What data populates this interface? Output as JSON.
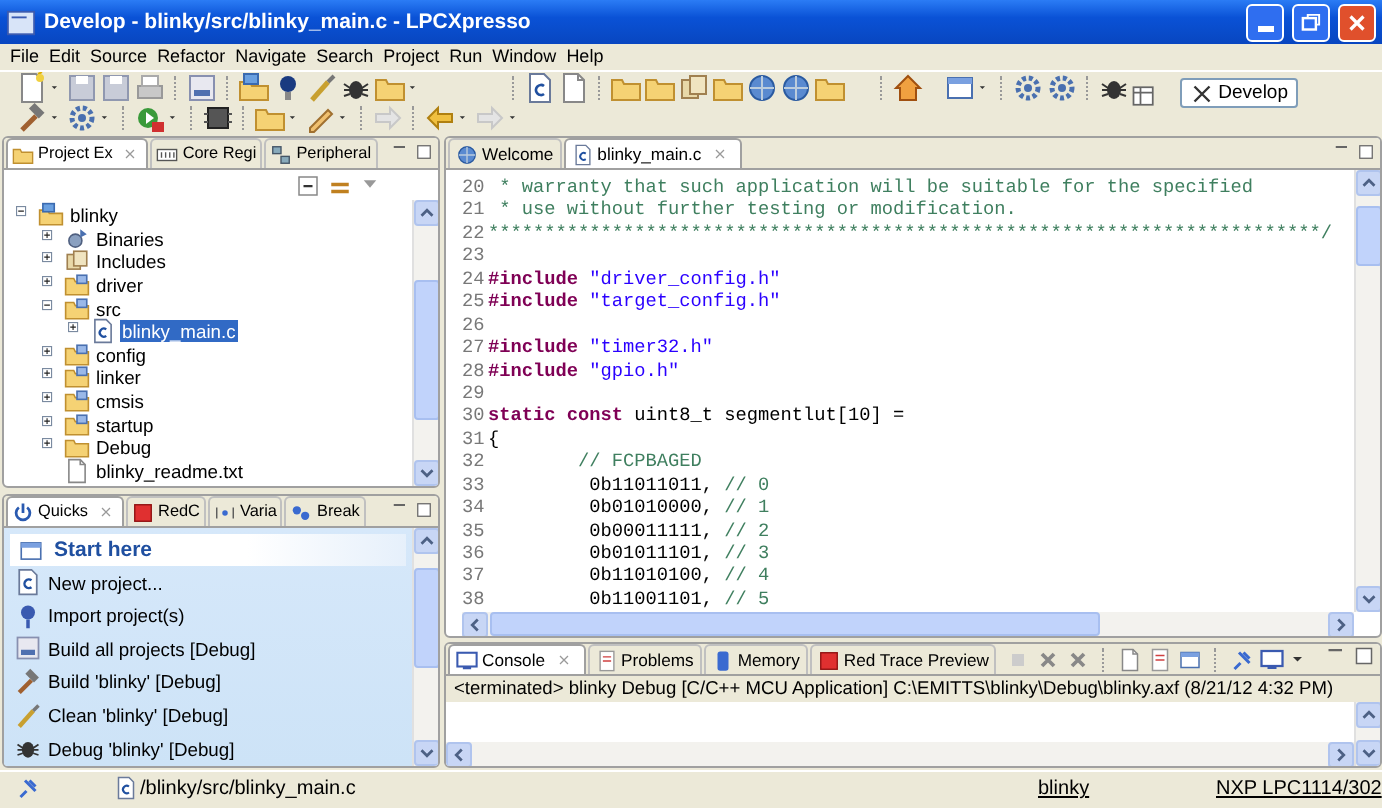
{
  "window": {
    "title": "Develop - blinky/src/blinky_main.c - LPCXpresso"
  },
  "menu": [
    "File",
    "Edit",
    "Source",
    "Refactor",
    "Navigate",
    "Search",
    "Project",
    "Run",
    "Window",
    "Help"
  ],
  "perspective": {
    "label": "Develop",
    "selected": true
  },
  "explorer_tabs": [
    {
      "label": "Project Ex",
      "selected": true
    },
    {
      "label": "Core Regi",
      "selected": false
    },
    {
      "label": "Peripheral",
      "selected": false
    }
  ],
  "tree": [
    {
      "label": "blinky",
      "kind": "project",
      "expanded": true,
      "selected": false,
      "children": [
        {
          "label": "Binaries",
          "kind": "binaries",
          "expanded": false,
          "selected": false
        },
        {
          "label": "Includes",
          "kind": "includes",
          "expanded": false,
          "selected": false
        },
        {
          "label": "driver",
          "kind": "folder",
          "expanded": false,
          "selected": false
        },
        {
          "label": "src",
          "kind": "folder",
          "expanded": true,
          "selected": false,
          "children": [
            {
              "label": "blinky_main.c",
              "kind": "c-file",
              "expanded": false,
              "selected": true
            }
          ]
        },
        {
          "label": "config",
          "kind": "folder",
          "expanded": false,
          "selected": false
        },
        {
          "label": "linker",
          "kind": "folder",
          "expanded": false,
          "selected": false
        },
        {
          "label": "cmsis",
          "kind": "folder",
          "expanded": false,
          "selected": false
        },
        {
          "label": "startup",
          "kind": "folder",
          "expanded": false,
          "selected": false
        },
        {
          "label": "Debug",
          "kind": "plain-folder",
          "expanded": false,
          "selected": false
        },
        {
          "label": "blinky_readme.txt",
          "kind": "text-file",
          "selected": false
        }
      ]
    }
  ],
  "quick_tabs": [
    {
      "label": "Quicks",
      "selected": true
    },
    {
      "label": "RedC",
      "selected": false
    },
    {
      "label": "Varia",
      "selected": false
    },
    {
      "label": "Break",
      "selected": false
    }
  ],
  "quick_panel": {
    "header": "Start here",
    "items": [
      {
        "kind": "new",
        "label": "New project..."
      },
      {
        "kind": "import",
        "label": "Import project(s)"
      },
      {
        "kind": "build-all",
        "label": "Build all projects [Debug]"
      },
      {
        "kind": "build",
        "label": "Build 'blinky' [Debug]"
      },
      {
        "kind": "clean",
        "label": "Clean 'blinky' [Debug]"
      },
      {
        "kind": "debug",
        "label": "Debug 'blinky' [Debug]"
      }
    ]
  },
  "editor_tabs": [
    {
      "label": "Welcome",
      "selected": false
    },
    {
      "label": "blinky_main.c",
      "selected": true
    }
  ],
  "code_lines": [
    {
      "number": "20",
      "parts": [
        {
          "kind": "comment",
          "text": " * warranty that such application will be suitable for the specified"
        }
      ]
    },
    {
      "number": "21",
      "parts": [
        {
          "kind": "comment",
          "text": " * use without further testing or modification."
        }
      ]
    },
    {
      "number": "22",
      "parts": [
        {
          "kind": "comment",
          "text": "**************************************************************************/"
        }
      ]
    },
    {
      "number": "23"
    },
    {
      "number": "24",
      "parts": [
        {
          "kind": "keyword",
          "text": "#include "
        },
        {
          "kind": "string",
          "text": "\"driver_config.h\""
        }
      ]
    },
    {
      "number": "25",
      "parts": [
        {
          "kind": "keyword",
          "text": "#include "
        },
        {
          "kind": "string",
          "text": "\"target_config.h\""
        }
      ]
    },
    {
      "number": "26"
    },
    {
      "number": "27",
      "parts": [
        {
          "kind": "keyword",
          "text": "#include "
        },
        {
          "kind": "string",
          "text": "\"timer32.h\""
        }
      ]
    },
    {
      "number": "28",
      "parts": [
        {
          "kind": "keyword",
          "text": "#include "
        },
        {
          "kind": "string",
          "text": "\"gpio.h\""
        }
      ]
    },
    {
      "number": "29"
    },
    {
      "number": "30",
      "parts": [
        {
          "kind": "keyword",
          "text": "static const"
        },
        {
          "kind": "plain",
          "text": " uint8_t segmentlut[10] ="
        }
      ]
    },
    {
      "number": "31",
      "parts": [
        {
          "kind": "plain",
          "text": "{"
        }
      ]
    },
    {
      "number": "32",
      "parts": [
        {
          "kind": "comment",
          "text": "        // FCPBAGED"
        }
      ]
    },
    {
      "number": "33",
      "parts": [
        {
          "kind": "plain",
          "text": "         0b11011011, "
        },
        {
          "kind": "comment",
          "text": "// 0"
        }
      ]
    },
    {
      "number": "34",
      "parts": [
        {
          "kind": "plain",
          "text": "         0b01010000, "
        },
        {
          "kind": "comment",
          "text": "// 1"
        }
      ]
    },
    {
      "number": "35",
      "parts": [
        {
          "kind": "plain",
          "text": "         0b00011111, "
        },
        {
          "kind": "comment",
          "text": "// 2"
        }
      ]
    },
    {
      "number": "36",
      "parts": [
        {
          "kind": "plain",
          "text": "         0b01011101, "
        },
        {
          "kind": "comment",
          "text": "// 3"
        }
      ]
    },
    {
      "number": "37",
      "parts": [
        {
          "kind": "plain",
          "text": "         0b11010100, "
        },
        {
          "kind": "comment",
          "text": "// 4"
        }
      ]
    },
    {
      "number": "38",
      "parts": [
        {
          "kind": "plain",
          "text": "         0b11001101, "
        },
        {
          "kind": "comment",
          "text": "// 5"
        }
      ]
    }
  ],
  "console_tabs": [
    {
      "label": "Console",
      "selected": true
    },
    {
      "label": "Problems",
      "selected": false
    },
    {
      "label": "Memory",
      "selected": false
    },
    {
      "label": "Red Trace Preview",
      "selected": false
    }
  ],
  "console": {
    "header": "<terminated> blinky Debug [C/C++ MCU Application] C:\\EMITTS\\blinky\\Debug\\blinky.axf (8/21/12 4:32 PM)"
  },
  "status_bar": {
    "path": "/blinky/src/blinky_main.c",
    "project": "blinky",
    "target": "NXP LPC1114/302"
  }
}
